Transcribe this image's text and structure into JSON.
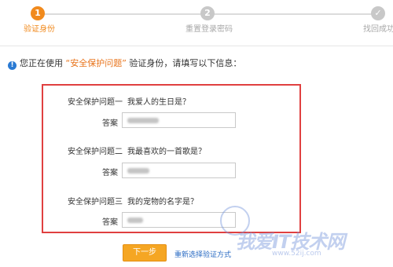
{
  "steps": [
    {
      "number": "1",
      "label": "验证身份",
      "state": "active"
    },
    {
      "number": "2",
      "label": "重置登录密码",
      "state": "pending"
    },
    {
      "number": "✓",
      "label": "找回成功",
      "state": "pending"
    }
  ],
  "notice": {
    "prefix": "您正在使用",
    "method": "“安全保护问题”",
    "suffix": "验证身份，请填写以下信息："
  },
  "questions": [
    {
      "label": "安全保护问题一",
      "text": "我爱人的生日是？",
      "answer_label": "答案"
    },
    {
      "label": "安全保护问题二",
      "text": "我最喜欢的一首歌是？",
      "answer_label": "答案"
    },
    {
      "label": "安全保护问题三",
      "text": "我的宠物的名字是？",
      "answer_label": "答案"
    }
  ],
  "actions": {
    "next_label": "下一步",
    "alt_label": "重新选择验证方式"
  },
  "watermark": {
    "title": "我爱IT技术网",
    "url": "www.52ij.com"
  },
  "colors": {
    "accent": "#f18a1d",
    "highlight_border": "#e04040",
    "link": "#2a6bc3",
    "inactive": "#c8c8c8"
  }
}
